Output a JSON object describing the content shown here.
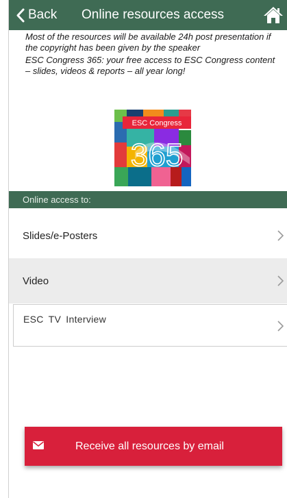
{
  "navbar": {
    "back_label": "Back",
    "title": "Online resources access",
    "color": "#3f6b54"
  },
  "intro": {
    "paragraph1": "Most of the resources will be available 24h post presentation if the copyright has been given by the speaker",
    "paragraph2": "ESC Congress 365: your free access to ESC Congress content – slides, videos & reports – all year long!"
  },
  "logo": {
    "banner_text": "ESC Congress",
    "number_text": "365"
  },
  "section": {
    "header": "Online access to:"
  },
  "rows": [
    {
      "label": "Slides/e-Posters",
      "icon": "chevron-right-icon"
    },
    {
      "label": "Video",
      "icon": "chevron-right-icon"
    },
    {
      "label": "ESC TV Interview",
      "icon": "chevron-right-icon"
    }
  ],
  "email_button": {
    "label": "Receive all resources by email",
    "icon": "mail-icon",
    "color": "#d8203b"
  }
}
